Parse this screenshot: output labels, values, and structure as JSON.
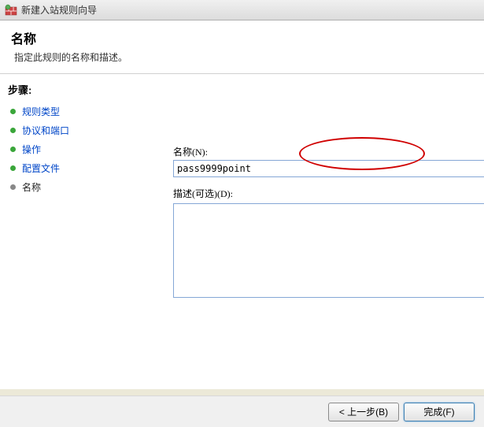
{
  "window": {
    "title": "新建入站规则向导"
  },
  "header": {
    "title": "名称",
    "subtitle": "指定此规则的名称和描述。"
  },
  "sidebar": {
    "steps_label": "步骤:",
    "items": [
      {
        "label": "规则类型",
        "completed": true
      },
      {
        "label": "协议和端口",
        "completed": true
      },
      {
        "label": "操作",
        "completed": true
      },
      {
        "label": "配置文件",
        "completed": true
      },
      {
        "label": "名称",
        "completed": false
      }
    ]
  },
  "main": {
    "name_label": "名称(N):",
    "name_value": "pass9999point",
    "desc_label": "描述(可选)(D):",
    "desc_value": ""
  },
  "footer": {
    "back": "< 上一步(B)",
    "finish": "完成(F)"
  }
}
